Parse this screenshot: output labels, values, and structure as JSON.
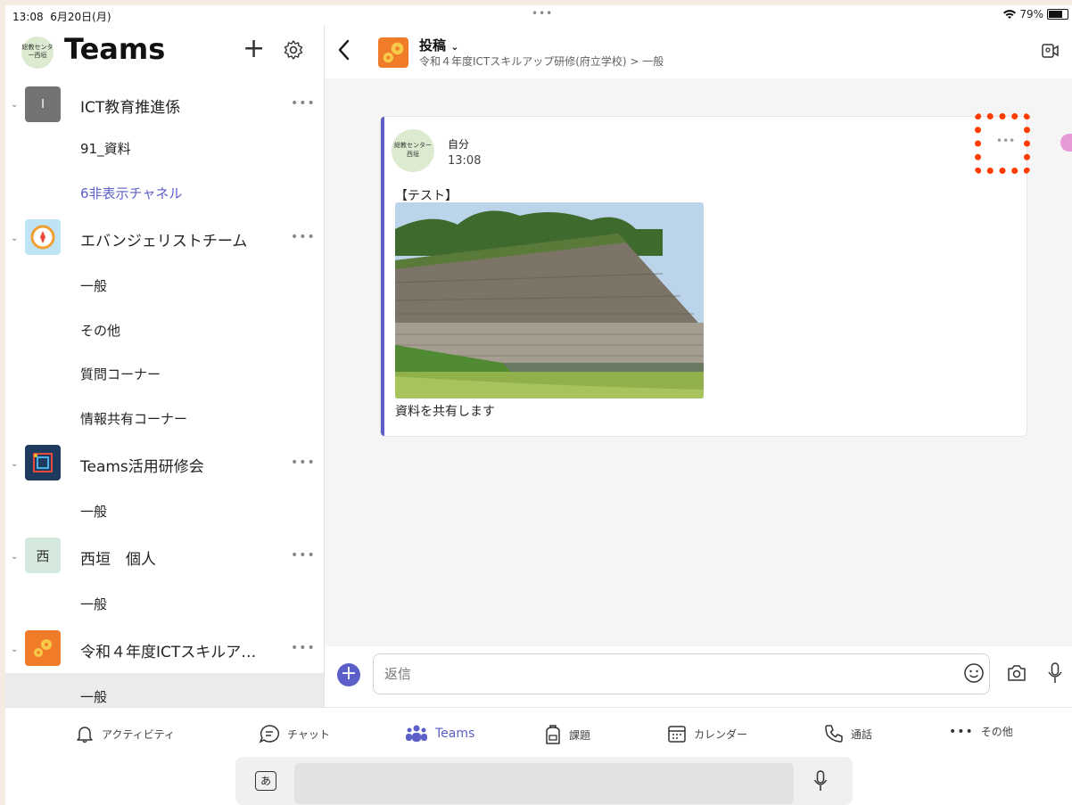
{
  "status": {
    "time": "13:08",
    "date": "6月20日(月)",
    "dots": "•••",
    "battery": "79%"
  },
  "sidebar": {
    "avatar_text": "総教センター西垣",
    "title": "Teams",
    "plus": "+",
    "teams": [
      {
        "name": "ICT教育推進係",
        "icon_text": "I",
        "icon_color": "#737373",
        "channels": [
          "91_資料",
          "6非表示チャネル"
        ]
      },
      {
        "name": "エバンジェリストチーム",
        "icon_text": "",
        "icon_color": "#bfe4f5",
        "channels": [
          "一般",
          "その他",
          "質問コーナー",
          "情報共有コーナー"
        ]
      },
      {
        "name": "Teams活用研修会",
        "icon_text": "",
        "icon_color": "#1e3a5f",
        "channels": [
          "一般"
        ]
      },
      {
        "name": "西垣　個人",
        "icon_text": "西",
        "icon_color": "#d4e8dd",
        "channels": [
          "一般"
        ]
      },
      {
        "name": "令和４年度ICTスキルア…",
        "icon_text": "",
        "icon_color": "#f07c2a",
        "channels": [
          "一般"
        ]
      }
    ],
    "more": "•••"
  },
  "main": {
    "channel_title": "投稿",
    "breadcrumb": "令和４年度ICTスキルアップ研修(府立学校) > 一般",
    "post": {
      "avatar_text": "総教センター西垣",
      "author": "自分",
      "time": "13:08",
      "text1": "【テスト】",
      "text2": "資料を共有します",
      "more": "•••"
    },
    "reply_placeholder": "返信"
  },
  "nav": [
    {
      "label": "アクティビティ",
      "icon": "bell-icon"
    },
    {
      "label": "チャット",
      "icon": "chat-icon"
    },
    {
      "label": "Teams",
      "icon": "teams-icon",
      "active": true
    },
    {
      "label": "課題",
      "icon": "backpack-icon"
    },
    {
      "label": "カレンダー",
      "icon": "calendar-icon"
    },
    {
      "label": "通話",
      "icon": "phone-icon"
    },
    {
      "label": "その他",
      "icon": "more-icon"
    }
  ],
  "keyboard": {
    "key_label": "あ"
  },
  "colors": {
    "accent": "#5b5fc7",
    "highlight": "#ff3c00"
  }
}
